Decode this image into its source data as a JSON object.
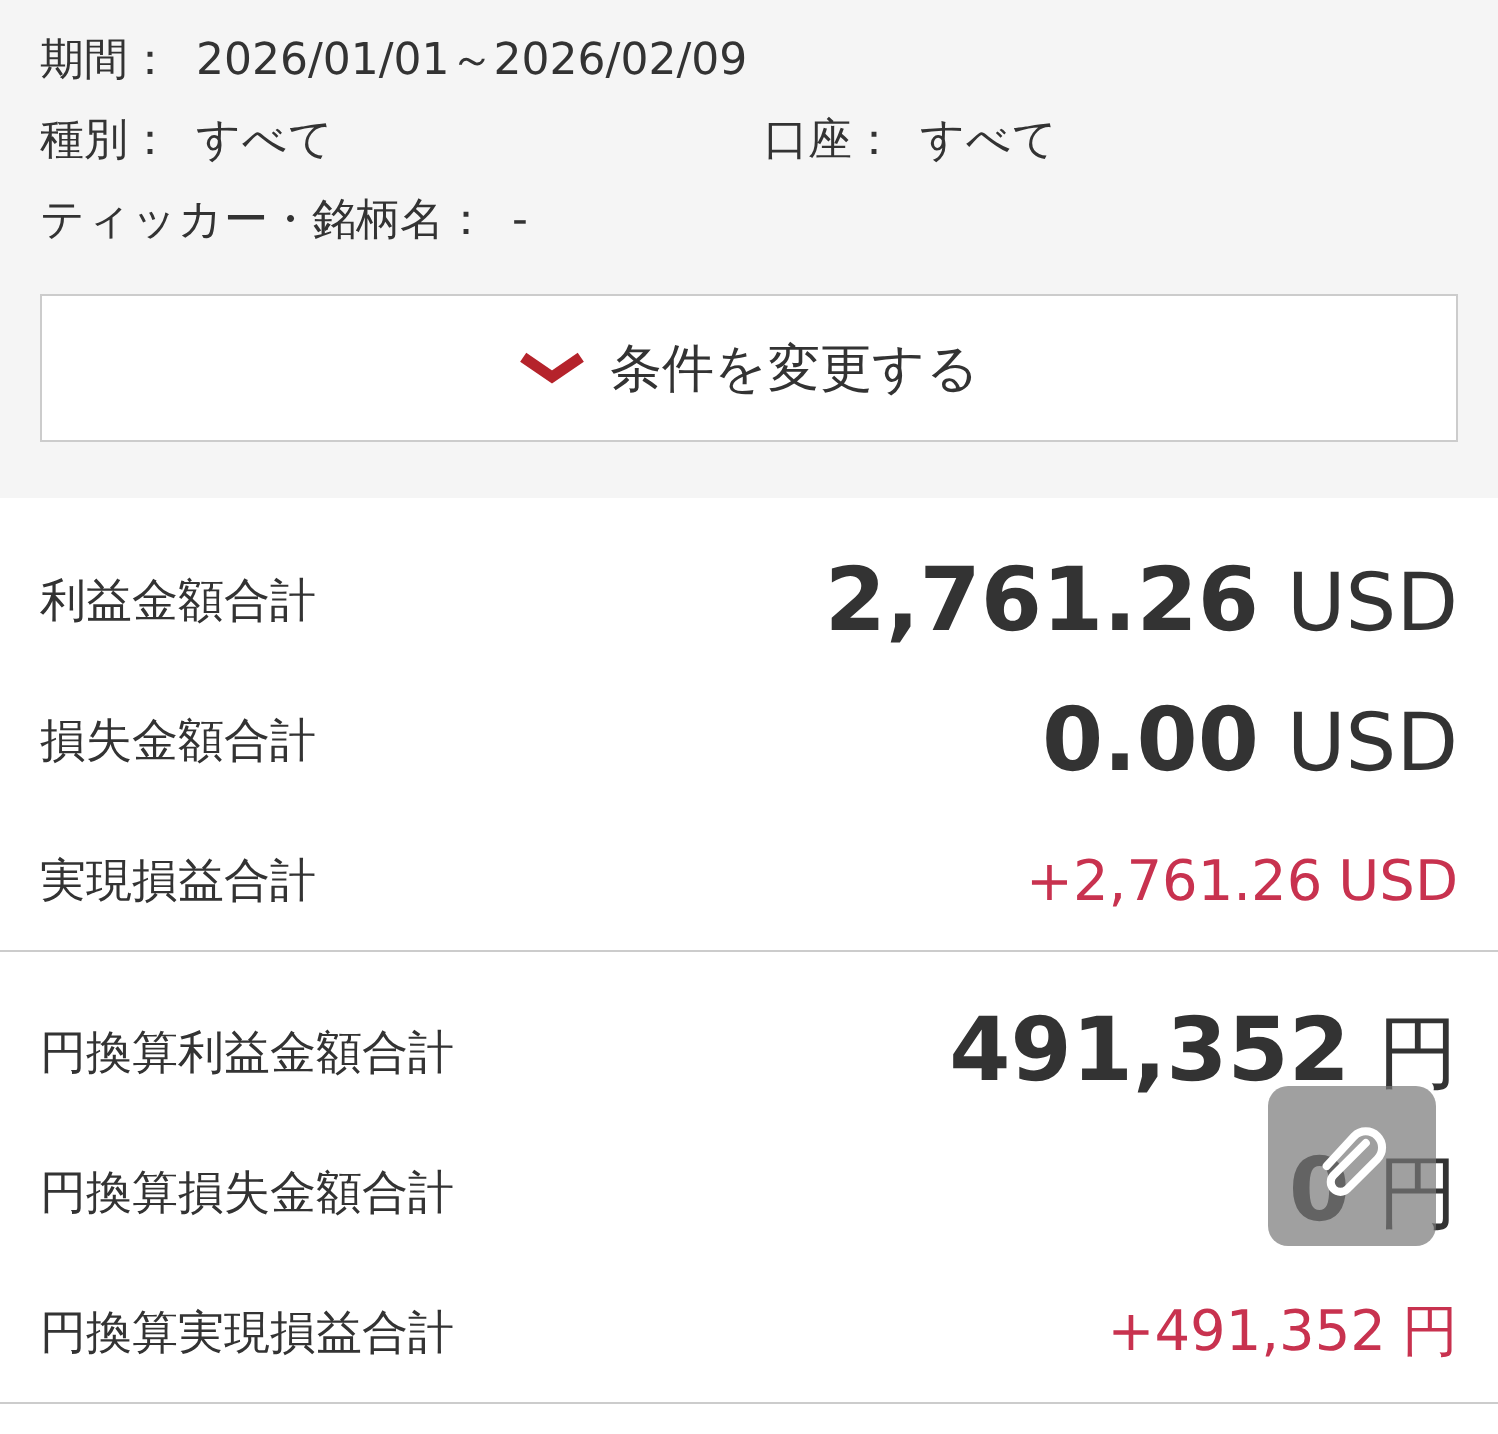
{
  "conditions": [
    {
      "fields": [
        {
          "label": "期間：",
          "value": "2026/01/01～2026/02/09"
        }
      ]
    },
    {
      "fields": [
        {
          "label": "種別：",
          "value": "すべて"
        },
        {
          "label": "口座：",
          "value": "すべて"
        }
      ]
    },
    {
      "fields": [
        {
          "label": "ティッカー・銘柄名：",
          "value": "-"
        }
      ]
    }
  ],
  "change_button": {
    "label": "条件を変更する"
  },
  "groups": [
    {
      "rows": [
        {
          "kind": "total",
          "label": "利益金額合計",
          "amount": "2,761.26",
          "unit": "USD"
        },
        {
          "kind": "total",
          "label": "損失金額合計",
          "amount": "0.00",
          "unit": "USD"
        },
        {
          "kind": "signed",
          "label": "実現損益合計",
          "amount": "+2,761.26",
          "unit": "USD"
        }
      ]
    },
    {
      "rows": [
        {
          "kind": "total",
          "label": "円換算利益金額合計",
          "amount": "491,352",
          "unit": "円"
        },
        {
          "kind": "total",
          "label": "円換算損失金額合計",
          "amount": "0",
          "unit": "円"
        },
        {
          "kind": "signed",
          "label": "円換算実現損益合計",
          "amount": "+491,352",
          "unit": "円"
        }
      ]
    }
  ]
}
